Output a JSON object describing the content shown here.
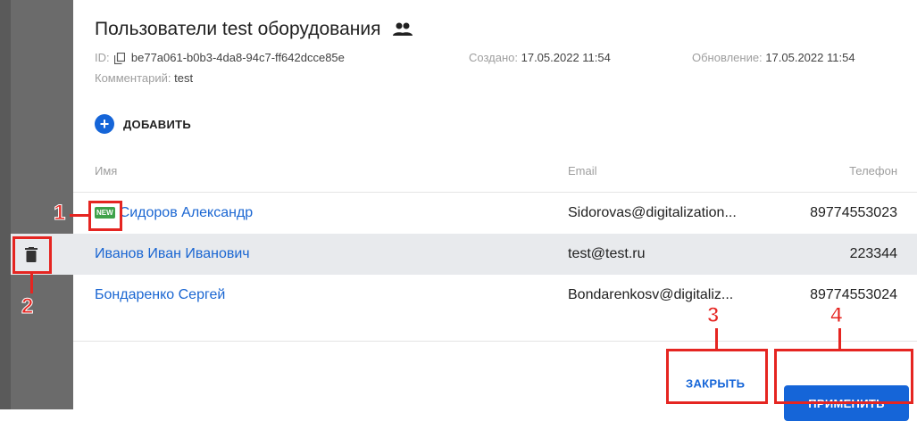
{
  "header": {
    "title": "Пользователи test оборудования",
    "id_label": "ID:",
    "id_value": "be77a061-b0b3-4da8-94c7-ff642dcce85e",
    "created_label": "Создано:",
    "created_value": "17.05.2022 11:54",
    "updated_label": "Обновление:",
    "updated_value": "17.05.2022 11:54",
    "comment_label": "Комментарий:",
    "comment_value": "test"
  },
  "toolbar": {
    "add_label": "ДОБАВИТЬ"
  },
  "table": {
    "columns": [
      "Имя",
      "Email",
      "Телефон"
    ],
    "rows": [
      {
        "name": "Сидоров Александр",
        "email": "Sidorovas@digitalization...",
        "phone": "89774553023",
        "badge": "NEW"
      },
      {
        "name": "Иванов Иван Иванович",
        "email": "test@test.ru",
        "phone": "223344"
      },
      {
        "name": "Бондаренко Сергей",
        "email": "Bondarenkosv@digitaliz...",
        "phone": "89774553024"
      }
    ]
  },
  "footer": {
    "close_label": "ЗАКРЫТЬ",
    "apply_label": "ПРИМЕНИТЬ"
  },
  "annotations": [
    "1",
    "2",
    "3",
    "4"
  ],
  "colors": {
    "accent": "#1565d8",
    "annotation": "#e52521",
    "new_badge": "#3fa24a"
  }
}
